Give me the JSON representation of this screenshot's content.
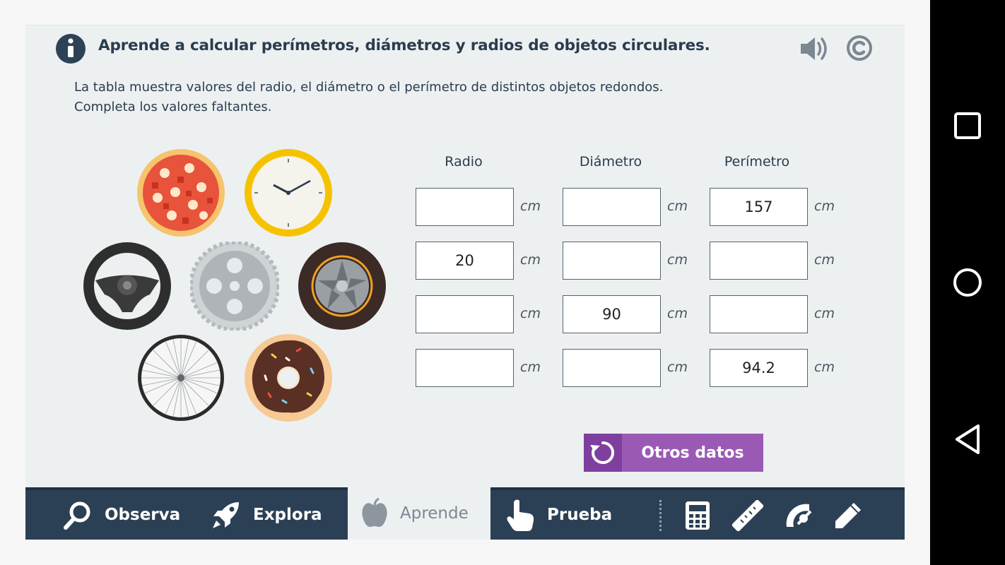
{
  "header": {
    "title": "Aprende a calcular perímetros, diámetros y radios de objetos circulares.",
    "info_icon": "info-icon",
    "sound_icon": "speaker-icon",
    "copyright_icon": "copyright-icon"
  },
  "instructions": {
    "line1": "La tabla muestra valores del radio, el diámetro o el perímetro de distintos objetos redondos.",
    "line2": "Completa los valores faltantes."
  },
  "objects": [
    "pizza",
    "clock",
    "steering-wheel",
    "gear",
    "tire",
    "bicycle-wheel",
    "donut"
  ],
  "table": {
    "headers": [
      "Radio",
      "Diámetro",
      "Perímetro"
    ],
    "unit": "cm",
    "rows": [
      {
        "radio": "",
        "diametro": "",
        "perimetro": "157"
      },
      {
        "radio": "20",
        "diametro": "",
        "perimetro": ""
      },
      {
        "radio": "",
        "diametro": "90",
        "perimetro": ""
      },
      {
        "radio": "",
        "diametro": "",
        "perimetro": "94.2"
      }
    ]
  },
  "button": {
    "label": "Otros datos",
    "icon": "refresh-icon"
  },
  "nav": {
    "items": [
      {
        "label": "Observa",
        "icon": "magnifier-icon"
      },
      {
        "label": "Explora",
        "icon": "rocket-icon"
      },
      {
        "label": "Aprende",
        "icon": "apple-icon",
        "active": true
      },
      {
        "label": "Prueba",
        "icon": "hand-pointer-icon"
      }
    ],
    "tools": [
      "calculator-icon",
      "ruler-icon",
      "protractor-icon",
      "pencil-icon"
    ]
  },
  "android": {
    "buttons": [
      "recents-icon",
      "home-icon",
      "back-icon"
    ]
  },
  "colors": {
    "accent": "#9b59b6",
    "nav_bg": "#2c4055",
    "text": "#2a3c4e"
  }
}
